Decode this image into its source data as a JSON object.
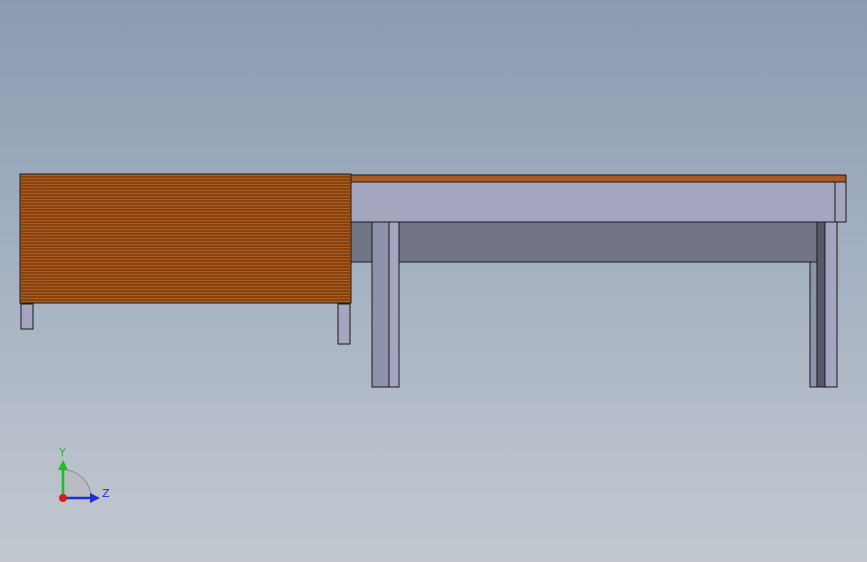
{
  "viewport": {
    "background_top": "#8a9bb0",
    "background_bottom": "#c3c8d0"
  },
  "model": {
    "stacked_boards_color": "#b05a1a",
    "board_line_color": "#3a2008",
    "table_top_color": "#a85a20",
    "frame_light_color": "#a4a6bf",
    "frame_dark_color": "#727586",
    "leg_color": "#8e92aa",
    "edge_color": "#1a1a1a"
  },
  "triad": {
    "y_label": "Y",
    "z_label": "Z",
    "y_axis_color": "#1fbf1f",
    "z_axis_color": "#1a2fd6",
    "x_axis_color": "#d61a1a"
  }
}
